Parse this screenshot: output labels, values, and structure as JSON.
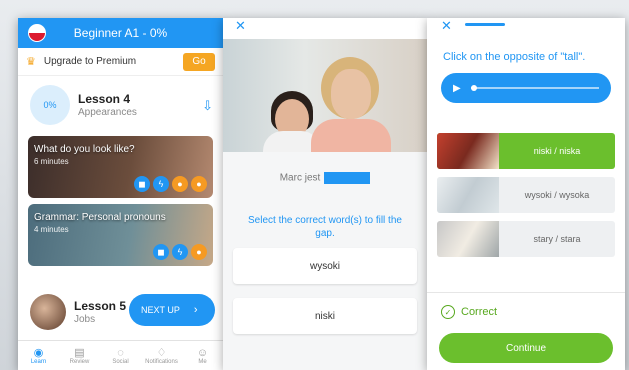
{
  "screen1": {
    "header_title": "Beginner A1 - 0%",
    "premium_text": "Upgrade to Premium",
    "premium_button": "Go",
    "lesson4": {
      "percent": "0%",
      "title": "Lesson 4",
      "subtitle": "Appearances"
    },
    "cards": [
      {
        "title": "What do you look like?",
        "time": "6 minutes"
      },
      {
        "title": "Grammar: Personal pronouns",
        "time": "4 minutes"
      }
    ],
    "lesson5": {
      "title": "Lesson 5",
      "subtitle": "Jobs"
    },
    "next_up": "NEXT UP",
    "tabs": [
      "Learn",
      "Review",
      "Social",
      "Notifications",
      "Me"
    ]
  },
  "screen2": {
    "sentence": "Marc jest",
    "instruction": "Select the correct word(s) to fill the gap.",
    "options": [
      "wysoki",
      "niski"
    ]
  },
  "screen3": {
    "question": "Click on the opposite of \"tall\".",
    "choices": [
      "niski / niska",
      "wysoki / wysoka",
      "stary / stara"
    ],
    "result": "Correct",
    "continue_label": "Continue"
  },
  "colors": {
    "primary_blue": "#2196f3",
    "green": "#6bbf2d",
    "orange": "#f5a623"
  }
}
